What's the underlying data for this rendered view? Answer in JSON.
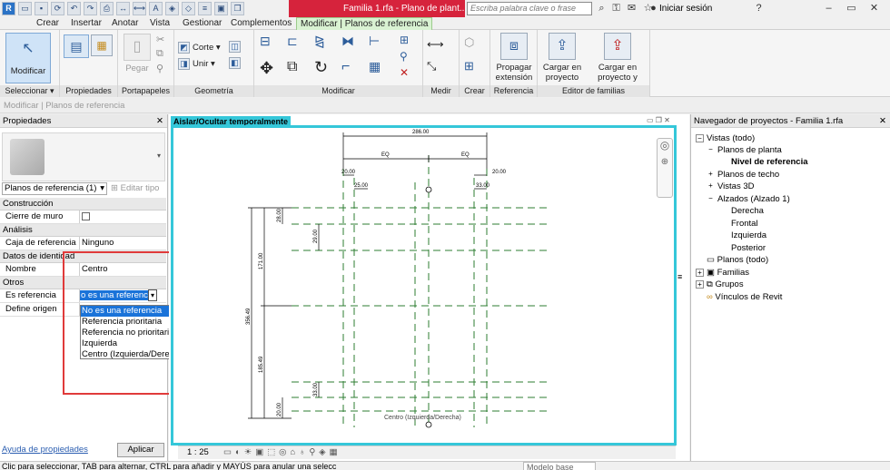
{
  "window": {
    "title": "Familia 1.rfa - Plano de plant...",
    "search_placeholder": "Escriba palabra clave o frase",
    "login": "Iniciar sesión"
  },
  "tabs": [
    "Crear",
    "Insertar",
    "Anotar",
    "Vista",
    "Gestionar",
    "Complementos",
    "Modificar | Planos de referencia"
  ],
  "ribbon": {
    "modificar": "Modificar",
    "pegar": "Pegar",
    "corte": "Corte",
    "unir": "Unir",
    "propagar": "Propagar extensión",
    "cargar_proyecto": "Cargar en proyecto",
    "cargar_cerrar": "Cargar en proyecto y cerrar",
    "panels": {
      "seleccionar": "Seleccionar",
      "propiedades": "Propiedades",
      "portapapeles": "Portapapeles",
      "geometria": "Geometría",
      "modificar": "Modificar",
      "medir": "Medir",
      "crear": "Crear",
      "referencia": "Referencia",
      "editor": "Editor de familias"
    }
  },
  "context_bar": "Modificar | Planos de referencia",
  "properties": {
    "title": "Propiedades",
    "type_selector": "Planos de referencia (1)",
    "edit_type": "Editar tipo",
    "sections": {
      "construccion": "Construcción",
      "analisis": "Análisis",
      "identidad": "Datos de identidad",
      "otros": "Otros"
    },
    "rows": {
      "cierre": "Cierre de muro",
      "caja": "Caja de referencia",
      "caja_val": "Ninguno",
      "nombre": "Nombre",
      "nombre_val": "Centro (Izquierda/...",
      "es_ref": "Es referencia",
      "es_ref_val": "o es una referencia",
      "define": "Define origen"
    },
    "help_link": "Ayuda de propiedades",
    "apply": "Aplicar",
    "dropdown_options": [
      "No es una referencia",
      "Referencia prioritaria",
      "Referencia no prioritaria",
      "Izquierda",
      "Centro (Izquierda/Derecha)"
    ]
  },
  "canvas": {
    "hide_label": "Aislar/Ocultar temporalmente",
    "scale": "1 : 25",
    "dims": {
      "top_total": "286.00",
      "eq_left": "EQ",
      "eq_right": "EQ",
      "d20_left": "20.00",
      "d25": "25.00",
      "d33_top": "33.00",
      "d20_right": "20.00",
      "d28": "28.00",
      "d29": "29.00",
      "d171": "171.00",
      "d356": "356.49",
      "d185": "185.49",
      "d33_bottom": "33.00",
      "d20_bottom": "20.00",
      "center_label": "Centro (Izquierda/Derecha)"
    }
  },
  "navigator": {
    "title": "Navegador de proyectos - Familia 1.rfa",
    "items": {
      "vistas": "Vistas (todo)",
      "planos_planta": "Planos de planta",
      "nivel_ref": "Nivel de referencia",
      "planos_techo": "Planos de techo",
      "vistas3d": "Vistas 3D",
      "alzados": "Alzados (Alzado 1)",
      "derecha": "Derecha",
      "frontal": "Frontal",
      "izquierda": "Izquierda",
      "posterior": "Posterior",
      "planos_todo": "Planos (todo)",
      "familias": "Familias",
      "grupos": "Grupos",
      "vinculos": "Vínculos de Revit"
    }
  },
  "status": {
    "hint": "Clic para seleccionar, TAB para alternar, CTRL para añadir y MAYÚS para anular una selecc",
    "model": "Modelo base"
  }
}
